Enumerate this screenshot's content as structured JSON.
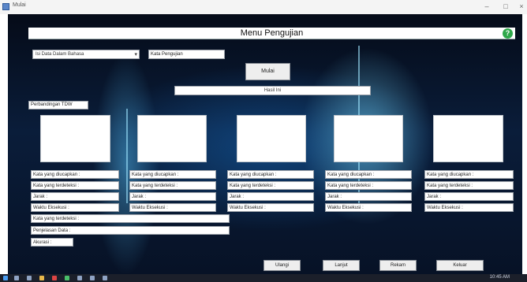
{
  "window": {
    "title": "Mulai"
  },
  "menu": {
    "title": "Menu Pengujian"
  },
  "controls": {
    "select_value": "Isi Data Dalam Bahasa",
    "input_label": "Kata Pengujian",
    "start_button": "Mulai",
    "status_text": "Hasil Ini"
  },
  "compare_label": "Perbandingan TDW",
  "columns": [
    {
      "f1": "Kata yang diucapkan :",
      "f2": "Kata yang terdeteksi :",
      "f3": "Jarak :",
      "f4": "Waktu Eksekusi :"
    },
    {
      "f1": "Kata yang diucapkan :",
      "f2": "Kata yang terdeteksi :",
      "f3": "Jarak :",
      "f4": "Waktu Eksekusi :"
    },
    {
      "f1": "Kata yang diucapkan :",
      "f2": "Kata yang terdeteksi :",
      "f3": "Jarak :",
      "f4": "Waktu Eksekusi :"
    },
    {
      "f1": "Kata yang diucapkan :",
      "f2": "Kata yang terdeteksi :",
      "f3": "Jarak :",
      "f4": "Waktu Eksekusi :"
    },
    {
      "f1": "Kata yang diucapkan :",
      "f2": "Kata yang terdeteksi :",
      "f3": "Jarak :",
      "f4": "Waktu Eksekusi :"
    }
  ],
  "summary": {
    "detected": "Kata yang terdeteksi :",
    "explanation": "Penjelasan Data :",
    "accuracy": "Akurasi :"
  },
  "buttons": {
    "b1": "Ulangi",
    "b2": "Lanjut",
    "b3": "Rekam",
    "b4": "Keluar"
  },
  "taskbar": {
    "clock": "10:45 AM"
  },
  "colors": {
    "background": "#0a1d3a",
    "accent": "#2fa84a"
  }
}
